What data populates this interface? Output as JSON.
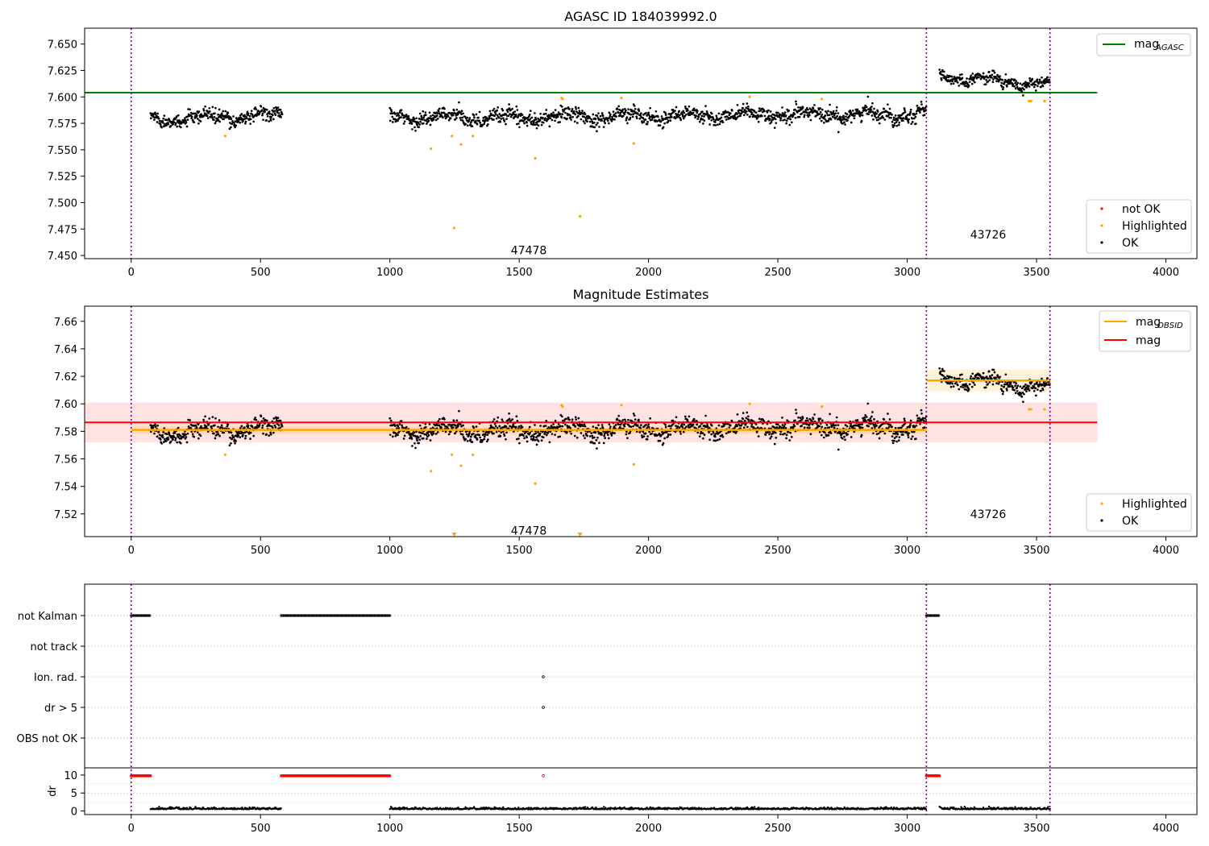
{
  "colors": {
    "ok": "#000000",
    "highlighted": "#ffa500",
    "not_ok": "#ff0000",
    "agasc_line": "#008000",
    "mag_line": "#ff0000",
    "obsid_line": "#ffa500",
    "vline": "#800080",
    "grid": "#b0b0b0"
  },
  "chart_data": [
    {
      "type": "scatter",
      "title": "AGASC ID 184039992.0",
      "xlim": [
        -180,
        4120
      ],
      "ylim": [
        7.447,
        7.665
      ],
      "xticks": [
        "0",
        "500",
        "1000",
        "1500",
        "2000",
        "2500",
        "3000",
        "3500",
        "4000"
      ],
      "yticks": [
        "7.450",
        "7.475",
        "7.500",
        "7.525",
        "7.550",
        "7.575",
        "7.600",
        "7.625",
        "7.650"
      ],
      "vlines": [
        0,
        3074,
        3552
      ],
      "hline": {
        "name": "mag",
        "subscript": "AGASC",
        "y": 7.604,
        "x0": -180,
        "x1": 3735
      },
      "legend_lines": [
        {
          "label": "mag",
          "subscript": "AGASC"
        }
      ],
      "legend_points": [
        "not OK",
        "Highlighted",
        "OK"
      ],
      "annotations": [
        {
          "text": "47478",
          "x": 1537,
          "y": 7.455
        },
        {
          "text": "43726",
          "x": 3313,
          "y": 7.47
        }
      ],
      "segments": [
        {
          "x0": 75,
          "x1": 585,
          "base": 7.578,
          "amp": 0.005,
          "noise": 0.006
        },
        {
          "x0": 1000,
          "x1": 3074,
          "base": 7.58,
          "amp": 0.004,
          "noise": 0.007
        },
        {
          "x0": 3125,
          "x1": 3552,
          "base": 7.62,
          "amp": -0.009,
          "noise": 0.005
        }
      ],
      "highlighted_points": [
        [
          363,
          7.563
        ],
        [
          1159,
          7.551
        ],
        [
          1240,
          7.563
        ],
        [
          1249,
          7.476
        ],
        [
          1275,
          7.555
        ],
        [
          1321,
          7.563
        ],
        [
          1562,
          7.542
        ],
        [
          1664,
          7.599
        ],
        [
          1668,
          7.598
        ],
        [
          1735,
          7.487
        ],
        [
          1895,
          7.599
        ],
        [
          1943,
          7.556
        ],
        [
          2391,
          7.6
        ],
        [
          2670,
          7.598
        ],
        [
          3471,
          7.596
        ],
        [
          3479,
          7.596
        ],
        [
          3531,
          7.596
        ]
      ]
    },
    {
      "type": "scatter",
      "title": "Magnitude Estimates",
      "xlim": [
        -180,
        4120
      ],
      "ylim": [
        7.5035,
        7.671
      ],
      "xticks": [
        "0",
        "500",
        "1000",
        "1500",
        "2000",
        "2500",
        "3000",
        "3500",
        "4000"
      ],
      "yticks": [
        "7.52",
        "7.54",
        "7.56",
        "7.58",
        "7.60",
        "7.62",
        "7.64",
        "7.66"
      ],
      "vlines": [
        0,
        3074,
        3552
      ],
      "mag_band": {
        "name": "mag",
        "y": 7.5865,
        "lo": 7.572,
        "hi": 7.601,
        "x0": -180,
        "x1": 3735
      },
      "obsid_lines": [
        {
          "x0": 0,
          "x1": 3074,
          "y": 7.581,
          "lo": 7.578,
          "hi": 7.584
        },
        {
          "x0": 3074,
          "x1": 3552,
          "y": 7.617,
          "lo": 7.609,
          "hi": 7.625
        }
      ],
      "legend_lines": [
        {
          "label": "mag",
          "subscript": "OBSID"
        },
        {
          "label": "mag",
          "subscript": ""
        }
      ],
      "legend_points": [
        "Highlighted",
        "OK"
      ],
      "annotations": [
        {
          "text": "47478",
          "x": 1537,
          "y": 7.508
        },
        {
          "text": "43726",
          "x": 3313,
          "y": 7.52
        }
      ],
      "offscale_markers": [
        1249,
        1735
      ]
    },
    {
      "type": "scatter",
      "title": "",
      "xlim": [
        -180,
        4120
      ],
      "xticks": [
        "0",
        "500",
        "1000",
        "1500",
        "2000",
        "2500",
        "3000",
        "3500",
        "4000"
      ],
      "flag_rows": [
        "not Kalman",
        "not track",
        "Ion. rad.",
        "dr > 5",
        "OBS not OK"
      ],
      "flags": {
        "not Kalman": [
          [
            0,
            75
          ],
          [
            580,
            1000
          ],
          [
            3074,
            3125
          ]
        ],
        "Ion. rad.": [
          [
            1593,
            1593
          ]
        ],
        "dr > 5": [
          [
            1593,
            1593
          ]
        ]
      },
      "dr_axis": {
        "ylabel": "dr",
        "yticks": [
          "0",
          "5",
          "10"
        ],
        "ylim": [
          -1,
          12
        ]
      },
      "dr_red_segments": [
        [
          0,
          75
        ],
        [
          580,
          1000
        ],
        [
          1593,
          1593
        ],
        [
          3074,
          3125
        ]
      ],
      "dr_black_segments": [
        [
          75,
          580
        ],
        [
          1000,
          3074
        ],
        [
          3125,
          3552
        ]
      ]
    }
  ]
}
